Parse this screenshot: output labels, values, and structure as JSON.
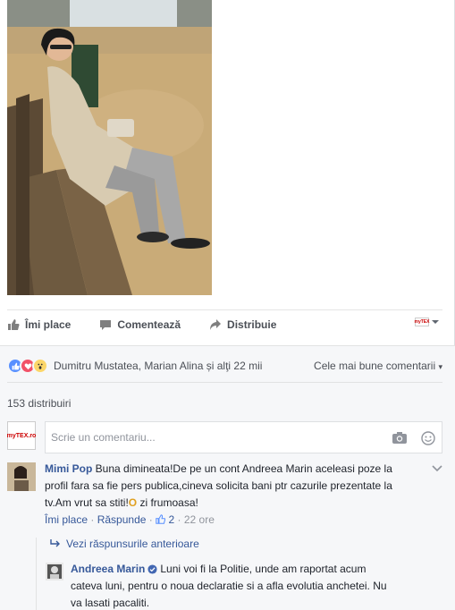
{
  "post": {
    "actions": {
      "like": "Îmi place",
      "comment": "Comentează",
      "share": "Distribuie"
    },
    "share_logo_text": "myTEX"
  },
  "reactions": {
    "names": "Dumitru Mustatea, Marian Alina și alţi 22 mii",
    "sort_label": "Cele mai bune comentarii",
    "sort_caret": "▾",
    "colors": {
      "like": "#5890ff",
      "love": "#f25268",
      "wow": "#fcd669"
    }
  },
  "shares": "153 distribuiri",
  "composer": {
    "avatar_text": "myTEX.ro",
    "placeholder": "Scrie un comentariu..."
  },
  "comments": [
    {
      "author": "Mimi Pop",
      "text_line1": " Buna dimineata!De pe un cont Andreea Marin aceleasi poze la",
      "text_line2": "profil fara sa fie pers publica,cineva solicita bani ptr cazurile prezentate la",
      "text_line3": "tv.Am vrut sa stiti!",
      "text_line3b": " zi frumoasa!",
      "emoji": "O",
      "like_label": "Îmi place",
      "reply_label": "Răspunde",
      "like_count": "2",
      "time": "22 ore"
    }
  ],
  "replies": {
    "view_previous": "Vezi răspunsurile anterioare",
    "items": [
      {
        "author": "Andreea Marin",
        "text_line1": "Luni voi fi la Politie, unde am raportat acum",
        "text_line2": "cateva luni, pentru o noua declaratie si a afla evolutia anchetei. Nu",
        "text_line3": "va lasati pacaliti."
      }
    ]
  }
}
